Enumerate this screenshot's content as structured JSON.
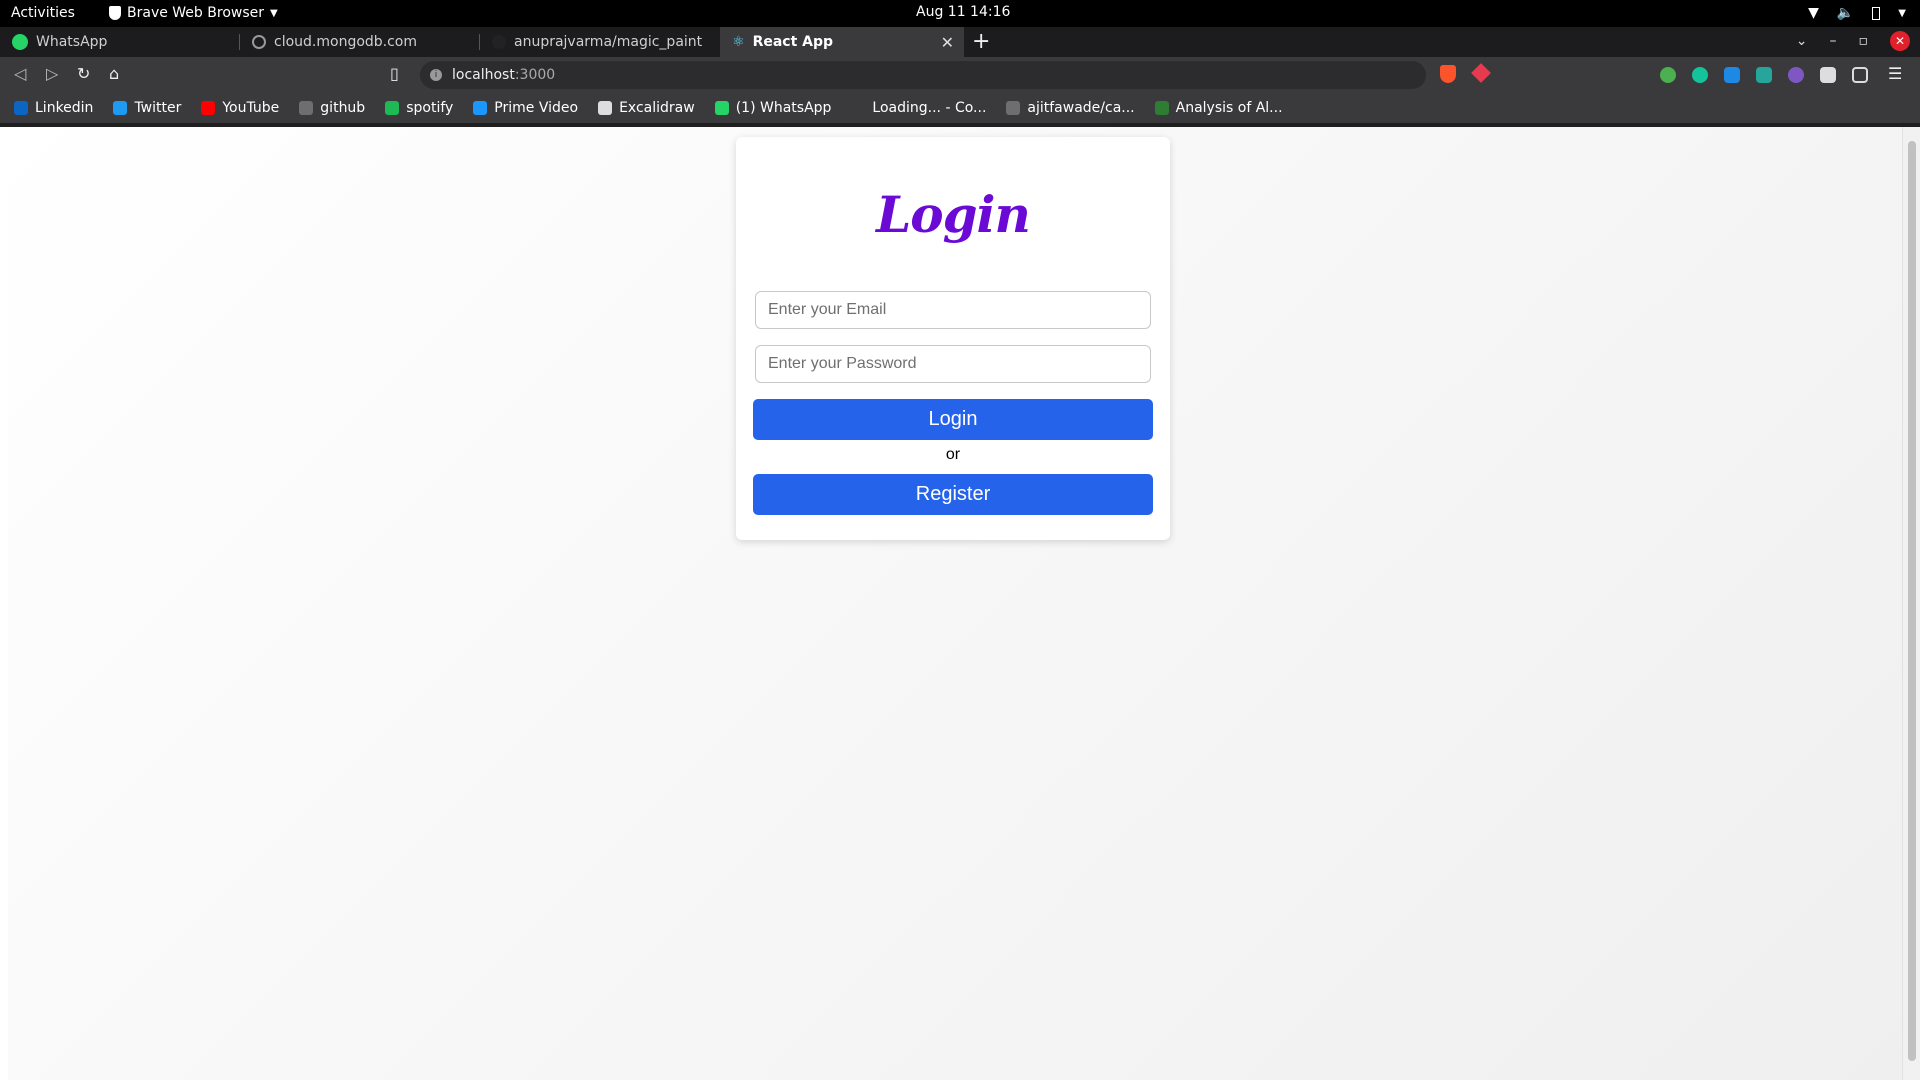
{
  "system": {
    "activities": "Activities",
    "app_name": "Brave Web Browser",
    "clock": "Aug 11  14:16"
  },
  "tabs": [
    {
      "label": "WhatsApp",
      "icon": "whatsapp-icon"
    },
    {
      "label": "cloud.mongodb.com",
      "icon": "globe-icon"
    },
    {
      "label": "anuprajvarma/magic_paint",
      "icon": "github-icon"
    },
    {
      "label": "React App",
      "icon": "react-icon",
      "active": true
    }
  ],
  "url": {
    "host": "localhost",
    "port": ":3000"
  },
  "bookmarks": [
    {
      "label": "Linkedin",
      "icon": "linkedin-icon",
      "color": "#0a66c2"
    },
    {
      "label": "Twitter",
      "icon": "twitter-icon",
      "color": "#1d9bf0"
    },
    {
      "label": "YouTube",
      "icon": "youtube-icon",
      "color": "#ff0000"
    },
    {
      "label": "github",
      "icon": "github-icon",
      "color": "#6e6e6e"
    },
    {
      "label": "spotify",
      "icon": "spotify-icon",
      "color": "#1db954"
    },
    {
      "label": "Prime Video",
      "icon": "prime-video-icon",
      "color": "#1a98ff"
    },
    {
      "label": "Excalidraw",
      "icon": "excalidraw-icon",
      "color": "#dddddd"
    },
    {
      "label": "(1) WhatsApp",
      "icon": "whatsapp-icon",
      "color": "#25d366"
    },
    {
      "label": "Loading... - Co...",
      "icon": "page-icon",
      "color": "#3a3a3c"
    },
    {
      "label": "ajitfawade/ca...",
      "icon": "github-icon",
      "color": "#6e6e6e"
    },
    {
      "label": "Analysis of Al...",
      "icon": "link-icon",
      "color": "#2e7d32"
    }
  ],
  "login": {
    "title": "Login",
    "email_placeholder": "Enter your Email",
    "password_placeholder": "Enter your Password",
    "login_button": "Login",
    "or_text": "or",
    "register_button": "Register"
  },
  "colors": {
    "brand": "#6a0ad4",
    "button": "#2563eb"
  }
}
